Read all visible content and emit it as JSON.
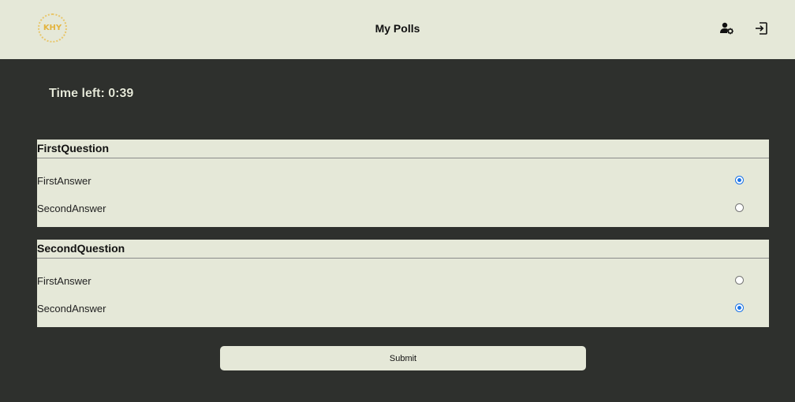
{
  "header": {
    "logo_text": "KHY",
    "title": "My Polls",
    "icons": [
      "user-settings-icon",
      "logout-icon"
    ]
  },
  "timer": {
    "text": "Time left: 0:39"
  },
  "questions": [
    {
      "title": "FirstQuestion",
      "answers": [
        {
          "label": "FirstAnswer",
          "selected": true
        },
        {
          "label": "SecondAnswer",
          "selected": false
        }
      ]
    },
    {
      "title": "SecondQuestion",
      "answers": [
        {
          "label": "FirstAnswer",
          "selected": false
        },
        {
          "label": "SecondAnswer",
          "selected": true
        }
      ]
    }
  ],
  "submit": {
    "label": "Submit"
  },
  "colors": {
    "background": "#2e302d",
    "panel": "#e5e8d8",
    "logo": "#e3b43f",
    "radio_checked": "#1a73e8"
  }
}
